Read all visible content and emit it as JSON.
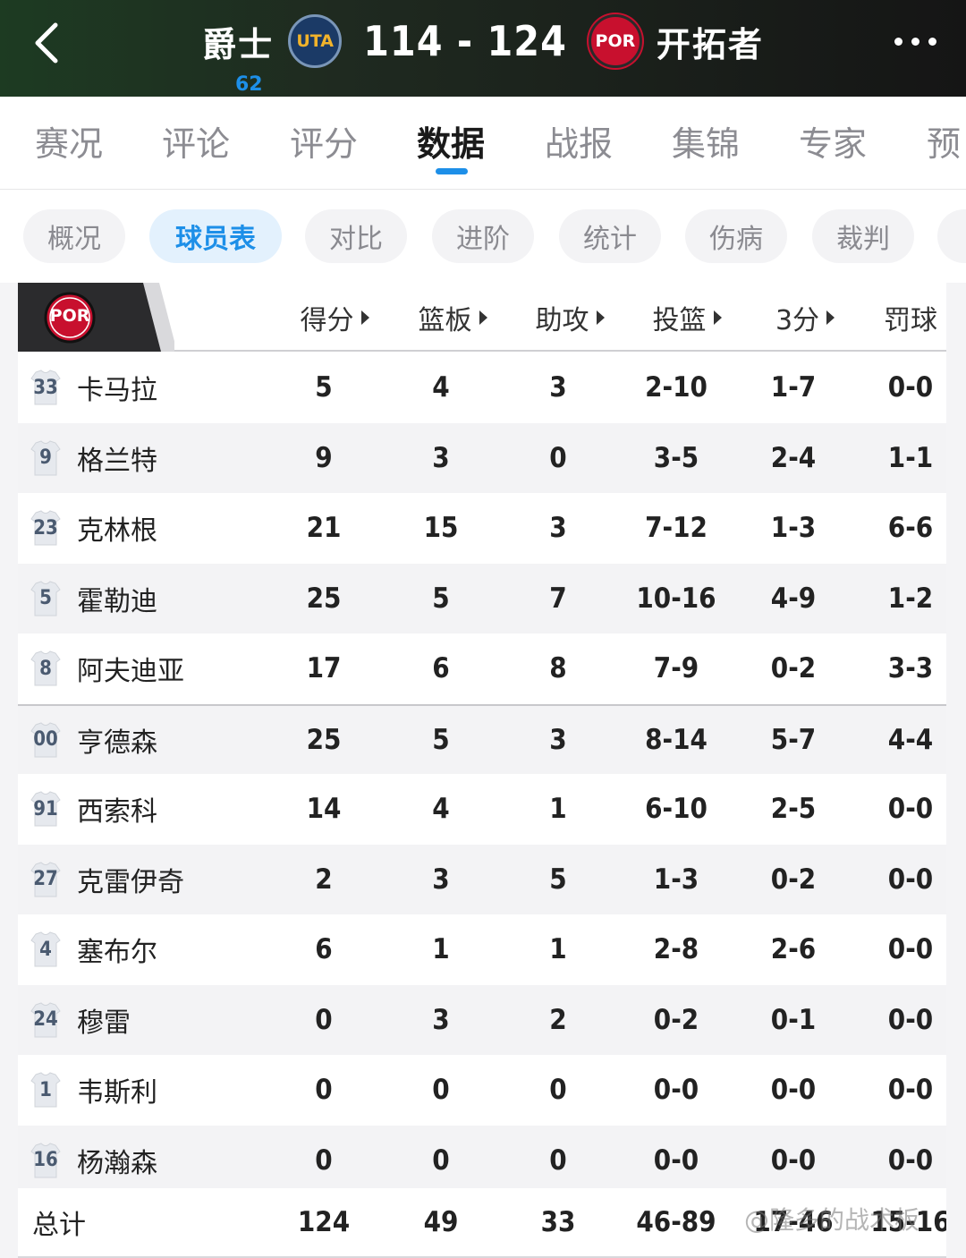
{
  "header": {
    "home_team": "爵士",
    "home_logo_text": "UTA",
    "score": "114 - 124",
    "away_team": "开拓者",
    "away_logo_text": "POR"
  },
  "main_tabs": [
    {
      "label": "赛况"
    },
    {
      "label": "评论",
      "badge": "62"
    },
    {
      "label": "评分"
    },
    {
      "label": "数据",
      "active": true
    },
    {
      "label": "战报"
    },
    {
      "label": "集锦"
    },
    {
      "label": "专家"
    },
    {
      "label": "预"
    }
  ],
  "sub_tabs": [
    {
      "label": "概况"
    },
    {
      "label": "球员表",
      "active": true
    },
    {
      "label": "对比"
    },
    {
      "label": "进阶"
    },
    {
      "label": "统计"
    },
    {
      "label": "伤病"
    },
    {
      "label": "裁判"
    }
  ],
  "table": {
    "team_logo_text": "POR",
    "columns": [
      "得分",
      "篮板",
      "助攻",
      "投篮",
      "3分",
      "罚球"
    ],
    "players": [
      {
        "num": "33",
        "name": "卡马拉",
        "pts": "5",
        "reb": "4",
        "ast": "3",
        "fg": "2-10",
        "tp": "1-7",
        "ft": "0-0"
      },
      {
        "num": "9",
        "name": "格兰特",
        "pts": "9",
        "reb": "3",
        "ast": "0",
        "fg": "3-5",
        "tp": "2-4",
        "ft": "1-1"
      },
      {
        "num": "23",
        "name": "克林根",
        "pts": "21",
        "reb": "15",
        "ast": "3",
        "fg": "7-12",
        "tp": "1-3",
        "ft": "6-6"
      },
      {
        "num": "5",
        "name": "霍勒迪",
        "pts": "25",
        "reb": "5",
        "ast": "7",
        "fg": "10-16",
        "tp": "4-9",
        "ft": "1-2"
      },
      {
        "num": "8",
        "name": "阿夫迪亚",
        "pts": "17",
        "reb": "6",
        "ast": "8",
        "fg": "7-9",
        "tp": "0-2",
        "ft": "3-3"
      },
      {
        "num": "00",
        "name": "亨德森",
        "pts": "25",
        "reb": "5",
        "ast": "3",
        "fg": "8-14",
        "tp": "5-7",
        "ft": "4-4"
      },
      {
        "num": "91",
        "name": "西索科",
        "pts": "14",
        "reb": "4",
        "ast": "1",
        "fg": "6-10",
        "tp": "2-5",
        "ft": "0-0"
      },
      {
        "num": "27",
        "name": "克雷伊奇",
        "pts": "2",
        "reb": "3",
        "ast": "5",
        "fg": "1-3",
        "tp": "0-2",
        "ft": "0-0"
      },
      {
        "num": "4",
        "name": "塞布尔",
        "pts": "6",
        "reb": "1",
        "ast": "1",
        "fg": "2-8",
        "tp": "2-6",
        "ft": "0-0"
      },
      {
        "num": "24",
        "name": "穆雷",
        "pts": "0",
        "reb": "3",
        "ast": "2",
        "fg": "0-2",
        "tp": "0-1",
        "ft": "0-0"
      },
      {
        "num": "1",
        "name": "韦斯利",
        "pts": "0",
        "reb": "0",
        "ast": "0",
        "fg": "0-0",
        "tp": "0-0",
        "ft": "0-0"
      },
      {
        "num": "16",
        "name": "杨瀚森",
        "pts": "0",
        "reb": "0",
        "ast": "0",
        "fg": "0-0",
        "tp": "0-0",
        "ft": "0-0"
      }
    ],
    "totals": {
      "label": "总计",
      "pts": "124",
      "reb": "49",
      "ast": "33",
      "fg": "46-89",
      "tp": "17-46",
      "ft": "15-16"
    }
  },
  "watermark": "@隆多的战术板",
  "colors": {
    "accent": "#1d8fe8",
    "por_red": "#c8102e",
    "uta_navy": "#1b3a66"
  },
  "icons": {
    "back": "chevron-left-icon",
    "more": "more-dots-icon"
  }
}
